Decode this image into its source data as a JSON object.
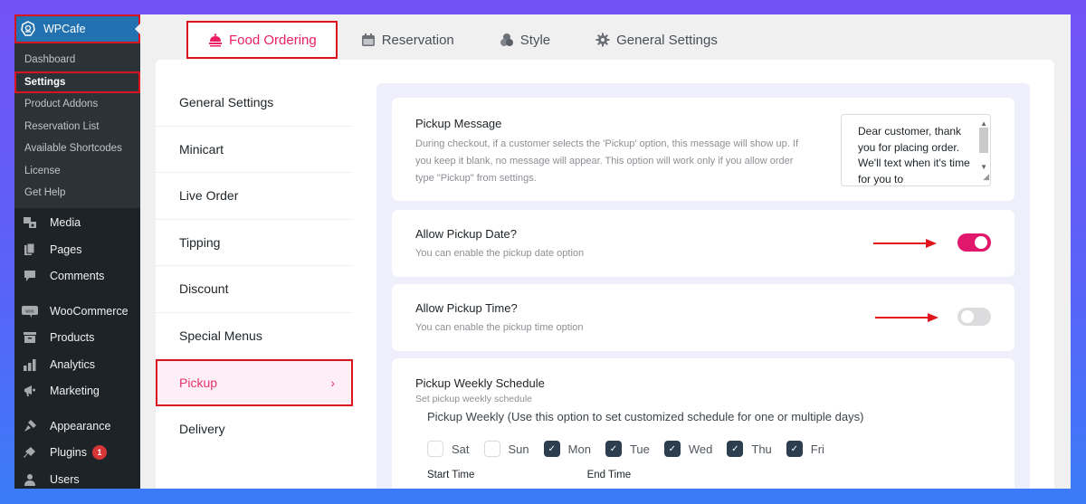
{
  "wp_sidebar": {
    "brand": "WPCafe",
    "submenu": [
      {
        "label": "Dashboard",
        "active": false
      },
      {
        "label": "Settings",
        "active": true
      },
      {
        "label": "Product Addons",
        "active": false
      },
      {
        "label": "Reservation List",
        "active": false
      },
      {
        "label": "Available Shortcodes",
        "active": false
      },
      {
        "label": "License",
        "active": false
      },
      {
        "label": "Get Help",
        "active": false
      }
    ],
    "menu": [
      {
        "label": "Media",
        "icon": "media-icon"
      },
      {
        "label": "Pages",
        "icon": "pages-icon"
      },
      {
        "label": "Comments",
        "icon": "comments-icon"
      },
      {
        "label": "WooCommerce",
        "icon": "woocommerce-icon"
      },
      {
        "label": "Products",
        "icon": "products-icon"
      },
      {
        "label": "Analytics",
        "icon": "analytics-icon"
      },
      {
        "label": "Marketing",
        "icon": "marketing-icon"
      },
      {
        "label": "Appearance",
        "icon": "appearance-icon"
      },
      {
        "label": "Plugins",
        "icon": "plugins-icon",
        "badge": "1"
      },
      {
        "label": "Users",
        "icon": "users-icon"
      }
    ]
  },
  "top_tabs": [
    {
      "label": "Food Ordering",
      "icon": "cloche-icon",
      "active": true
    },
    {
      "label": "Reservation",
      "icon": "calendar-icon",
      "active": false
    },
    {
      "label": "Style",
      "icon": "palette-icon",
      "active": false
    },
    {
      "label": "General Settings",
      "icon": "gear-icon",
      "active": false
    }
  ],
  "subnav": [
    {
      "label": "General Settings",
      "active": false
    },
    {
      "label": "Minicart",
      "active": false
    },
    {
      "label": "Live Order",
      "active": false
    },
    {
      "label": "Tipping",
      "active": false
    },
    {
      "label": "Discount",
      "active": false
    },
    {
      "label": "Special Menus",
      "active": false
    },
    {
      "label": "Pickup",
      "active": true,
      "chevron": "›"
    },
    {
      "label": "Delivery",
      "active": false
    }
  ],
  "pickup": {
    "message": {
      "title": "Pickup Message",
      "description": "During checkout, if a customer selects the 'Pickup' option, this message will show up. If you keep it blank, no message will appear. This option will work only if you allow order type \"Pickup\" from settings.",
      "value": "Dear customer, thank you for placing order. We'll text when it's time for you to"
    },
    "allow_date": {
      "title": "Allow Pickup Date?",
      "description": "You can enable the pickup date option",
      "enabled": true
    },
    "allow_time": {
      "title": "Allow Pickup Time?",
      "description": "You can enable the pickup time option",
      "enabled": false
    },
    "weekly": {
      "title": "Pickup Weekly Schedule",
      "description": "Set pickup weekly schedule",
      "subtitle": "Pickup Weekly (Use this option to set customized schedule for one or multiple days)",
      "days": [
        {
          "label": "Sat",
          "checked": false
        },
        {
          "label": "Sun",
          "checked": false
        },
        {
          "label": "Mon",
          "checked": true
        },
        {
          "label": "Tue",
          "checked": true
        },
        {
          "label": "Wed",
          "checked": true
        },
        {
          "label": "Thu",
          "checked": true
        },
        {
          "label": "Fri",
          "checked": true
        }
      ],
      "start_time_label": "Start Time",
      "end_time_label": "End Time"
    }
  },
  "colors": {
    "accent": "#e0176a",
    "wp_blue": "#2271b1",
    "checkbox_checked": "#2c3e50",
    "highlight_border": "#d9141e"
  }
}
